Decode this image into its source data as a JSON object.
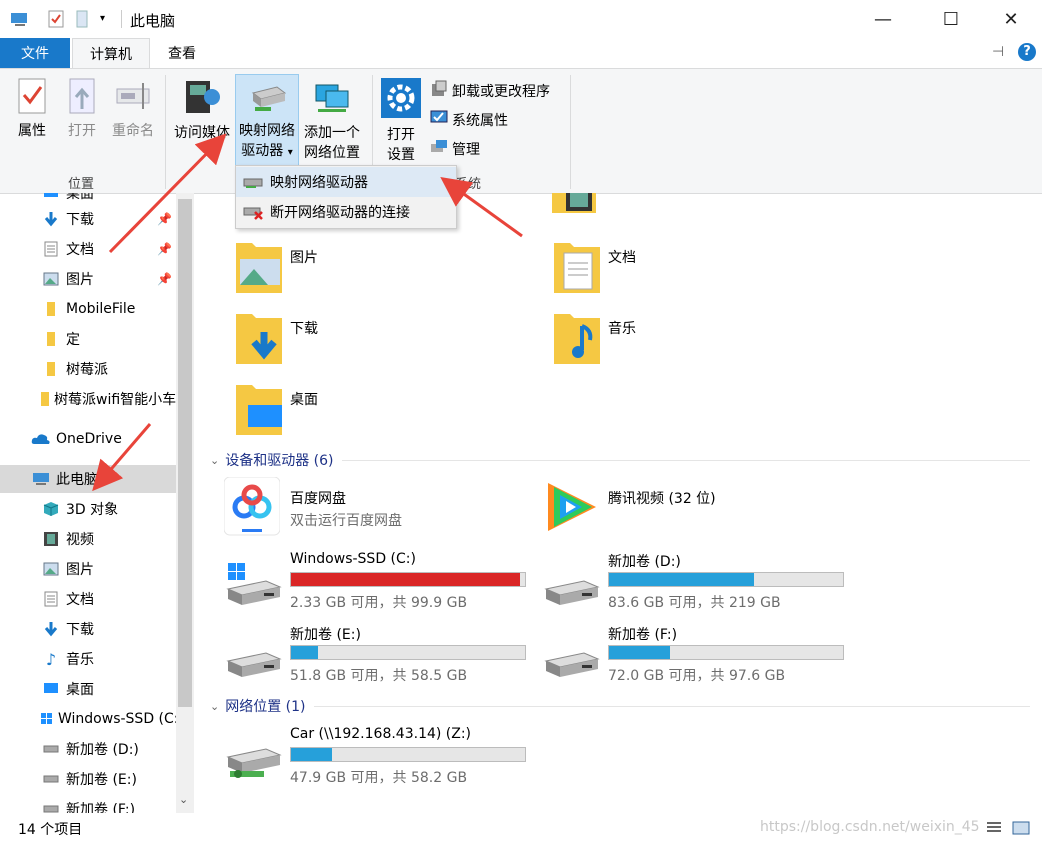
{
  "window": {
    "title": "此电脑",
    "minimize": "—",
    "maximize": "☐",
    "close": "✕"
  },
  "tabs": {
    "file": "文件",
    "computer": "计算机",
    "view": "查看"
  },
  "ribbon": {
    "location_group": "位置",
    "properties": "属性",
    "open": "打开",
    "rename": "重命名",
    "access_media": "访问媒体",
    "map_drive_1": "映射网络",
    "map_drive_2": "驱动器",
    "add_location_1": "添加一个",
    "add_location_2": "网络位置",
    "open_settings_1": "打开",
    "open_settings_2": "设置",
    "uninstall": "卸载或更改程序",
    "system_properties": "系统属性",
    "manage": "管理",
    "system_group": "系统"
  },
  "dropdown": {
    "map": "映射网络驱动器",
    "disconnect": "断开网络驱动器的连接"
  },
  "sidebar": {
    "desktop_partial": "桌面",
    "downloads": "下载",
    "documents": "文档",
    "pictures": "图片",
    "mobilefile": "MobileFile",
    "ding": "定",
    "raspberry": "树莓派",
    "raspberry_wifi": "树莓派wifi智能小车",
    "onedrive": "OneDrive",
    "this_pc": "此电脑",
    "objects3d": "3D 对象",
    "videos": "视频",
    "pictures2": "图片",
    "documents2": "文档",
    "downloads2": "下载",
    "music": "音乐",
    "desktop": "桌面",
    "windows_ssd": "Windows-SSD (C:)",
    "vol_d": "新加卷 (D:)",
    "vol_e": "新加卷 (E:)",
    "vol_f": "新加卷 (F:)"
  },
  "folders": {
    "pictures": "图片",
    "documents": "文档",
    "downloads": "下载",
    "music": "音乐",
    "desktop": "桌面"
  },
  "sections": {
    "devices": "设备和驱动器 (6)",
    "network": "网络位置 (1)"
  },
  "apps": {
    "baidu_name": "百度网盘",
    "baidu_desc": "双击运行百度网盘",
    "tencent": "腾讯视频 (32 位)"
  },
  "drives": [
    {
      "name": "Windows-SSD (C:)",
      "info": "2.33 GB 可用，共 99.9 GB",
      "used": 0.977
    },
    {
      "name": "新加卷 (D:)",
      "info": "83.6 GB 可用，共 219 GB",
      "used": 0.618
    },
    {
      "name": "新加卷 (E:)",
      "info": "51.8 GB 可用，共 58.5 GB",
      "used": 0.115
    },
    {
      "name": "新加卷 (F:)",
      "info": "72.0 GB 可用，共 97.6 GB",
      "used": 0.262
    },
    {
      "name": "Car (\\\\192.168.43.14) (Z:)",
      "info": "47.9 GB 可用，共 58.2 GB",
      "used": 0.177
    }
  ],
  "status": {
    "items": "14 个项目",
    "watermark": "https://blog.csdn.net/weixin_45"
  },
  "colors": {
    "accent": "#1979ca",
    "bar_fill": "#26a0da",
    "bar_full": "#da2626",
    "arrow": "#e8443a"
  }
}
